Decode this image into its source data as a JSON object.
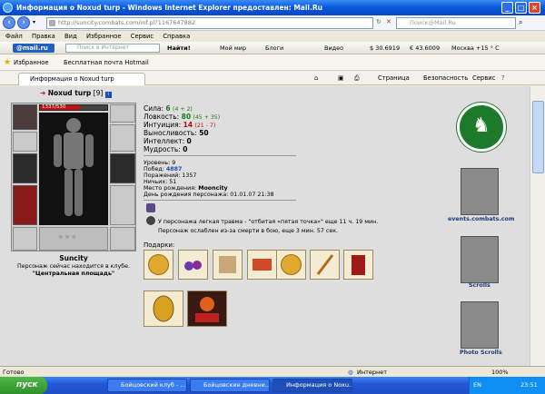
{
  "window": {
    "title": "Информация о Noxud turp - Windows Internet Explorer предоставлен: Mail.Ru",
    "url": "http://suncity.combats.com/inf.pl?1167647882",
    "search_placeholder": "Поиск@Mail.Ru"
  },
  "menu": [
    "Файл",
    "Правка",
    "Вид",
    "Избранное",
    "Сервис",
    "Справка"
  ],
  "mailbar": {
    "logo": "@mail.ru",
    "search_placeholder": "Поиск в Интернет",
    "find": "Найти!",
    "my_world": "Мой мир",
    "blogs": "Блоги",
    "video": "Видео",
    "usd": "$ 30.6919",
    "eur": "€ 43.6009",
    "weather": "Москва +15 ° С"
  },
  "favbar": {
    "favorites": "Избранное",
    "hotmail": "Бесплатная почта Hotmail"
  },
  "tabs": {
    "active": "Информация о Noxud turp",
    "page": "Страница",
    "safety": "Безопасность",
    "service": "Сервис"
  },
  "character": {
    "name": "Noxud turp",
    "level": "[9]",
    "hp": "1337/530",
    "city": "Suncity",
    "location_line": "Персонаж сейчас находится в клубе.",
    "location": "\"Центральная площадь\""
  },
  "stats": {
    "strength_label": "Сила:",
    "strength": "6",
    "strength_extra": "(4 + 2)",
    "agility_label": "Ловкость:",
    "agility": "80",
    "agility_extra": "(45 + 35)",
    "intuition_label": "Интуиция:",
    "intuition": "14",
    "intuition_extra": "(21 - 7)",
    "endurance_label": "Выносливость:",
    "endurance": "50",
    "intellect_label": "Интеллект:",
    "intellect": "0",
    "wisdom_label": "Мудрость:",
    "wisdom": "0"
  },
  "info": {
    "level": "Уровень: 9",
    "wins_label": "Побед:",
    "wins": "4887",
    "losses": "Поражений: 1357",
    "draws": "Ничьих: 51",
    "birthplace_label": "Место рождения:",
    "birthplace": "Mooncity",
    "birthday": "День рождения персонажа: 01.01.07 21:38"
  },
  "effects": {
    "trauma": "У персонажа легкая травма - \"отбитая «пятая точка»\" еще 11 ч. 19 мин.",
    "weakness": "Персонаж ослаблен из-за смерти в бою, еще 3 мин. 57 сек."
  },
  "gifts_title": "Подарки:",
  "side": {
    "events": "events.combats.com",
    "scrolls": "Scrolls",
    "photo_scrolls": "Photo Scrolls"
  },
  "status": {
    "left": "Готово",
    "zone": "Интернет",
    "zoom": "100%"
  },
  "taskbar": {
    "start": "пуск",
    "items": [
      "Бойцовский клуб - ...",
      "Бойцовские дневни...",
      "Информация о Noxu..."
    ],
    "lang": "EN",
    "clock": "23:51"
  },
  "colors": {
    "titlebar": "#0a57d8",
    "start_button": "#3a9b35",
    "green_stat": "#1a7a1a",
    "red_stat": "#b01010",
    "events_circle": "#1c7a2a"
  }
}
